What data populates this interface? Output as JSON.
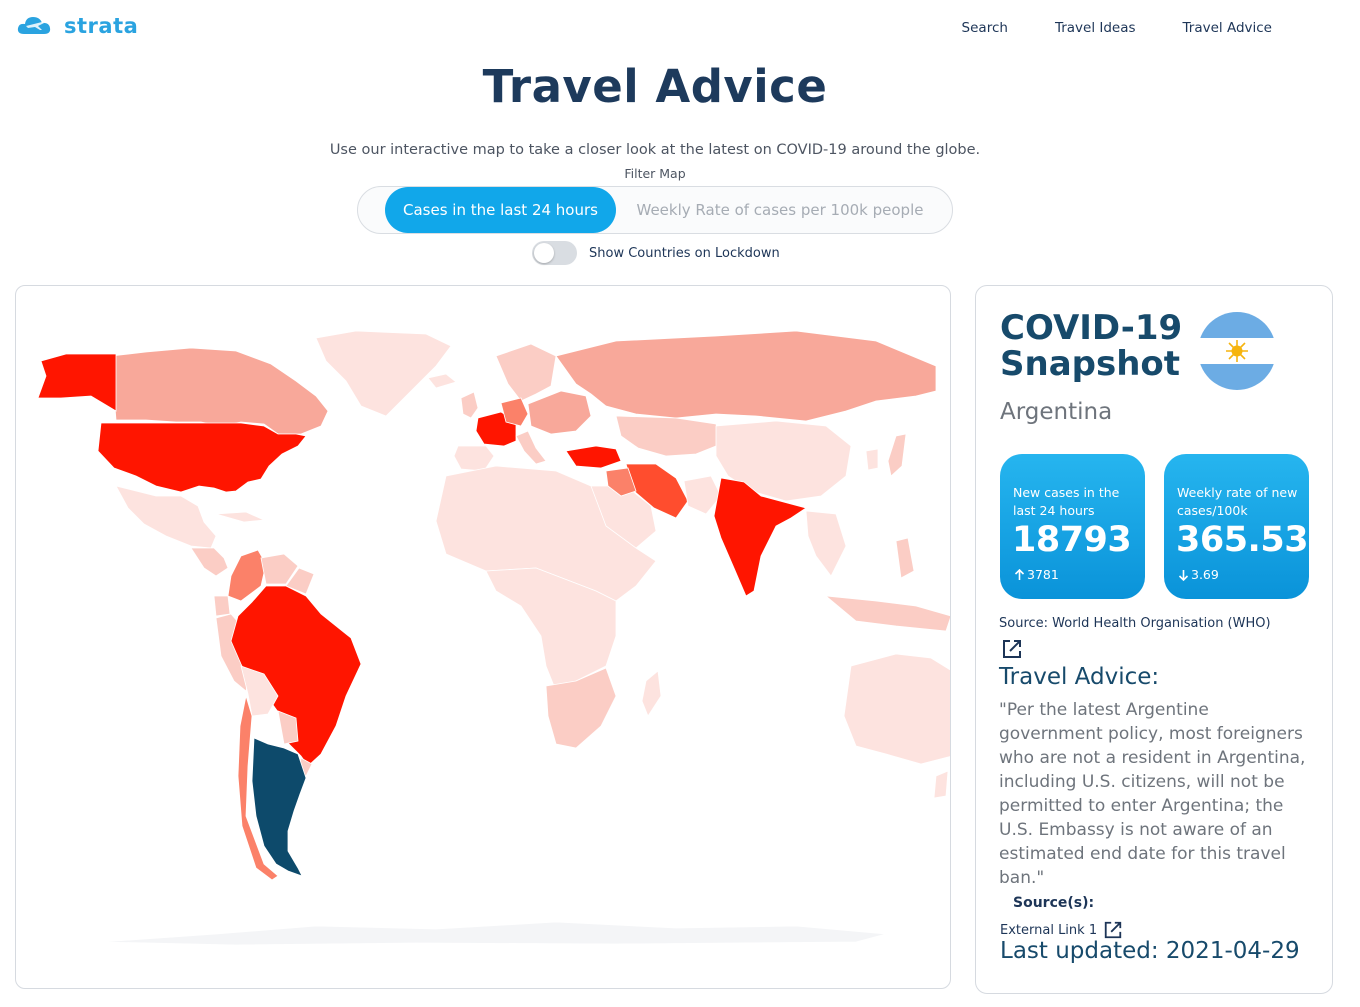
{
  "header": {
    "logo_text": "strata",
    "logo_icon": "cloud-plane-icon",
    "nav": [
      "Search",
      "Travel Ideas",
      "Travel Advice"
    ]
  },
  "page": {
    "title": "Travel Advice",
    "intro": "Use our interactive map to take a closer look at the latest on COVID-19 around the globe.",
    "filter_label": "Filter Map",
    "filter_options": [
      "Cases in the last 24 hours",
      "Weekly Rate of cases per 100k people"
    ],
    "active_filter": "Cases in the last 24 hours",
    "lockdown_toggle_label": "Show Countries on Lockdown",
    "lockdown_toggle_on": false
  },
  "map": {
    "selected_country": "Argentina",
    "selected_color": "#0d4a6b",
    "color_scale": {
      "lowest": "#fde3df",
      "low": "#fbcdc5",
      "medium": "#f8a89a",
      "high": "#fb8169",
      "higher": "#ff4d2e",
      "highest": "#ff1500"
    }
  },
  "snapshot": {
    "title": "COVID-19 Snapshot",
    "country": "Argentina",
    "flag_icon": "argentina-flag-icon",
    "stats": [
      {
        "label": "New cases in the last 24 hours",
        "value": "18793",
        "change": "3781",
        "direction": "up"
      },
      {
        "label": "Weekly rate of new cases/100k",
        "value": "365.53",
        "change": "3.69",
        "direction": "down"
      }
    ],
    "source_text": "Source: World Health Organisation (WHO)",
    "advice_title": "Travel Advice:",
    "advice_text": "\"Per the latest Argentine government policy, most foreigners who are not a resident in Argentina, including U.S. citizens, will not be permitted to enter Argentina; the U.S. Embassy is not aware of an estimated end date for this travel ban.\"",
    "sources_label": "Source(s):",
    "external_link": "External Link 1",
    "last_updated": "Last updated: 2021-04-29"
  }
}
